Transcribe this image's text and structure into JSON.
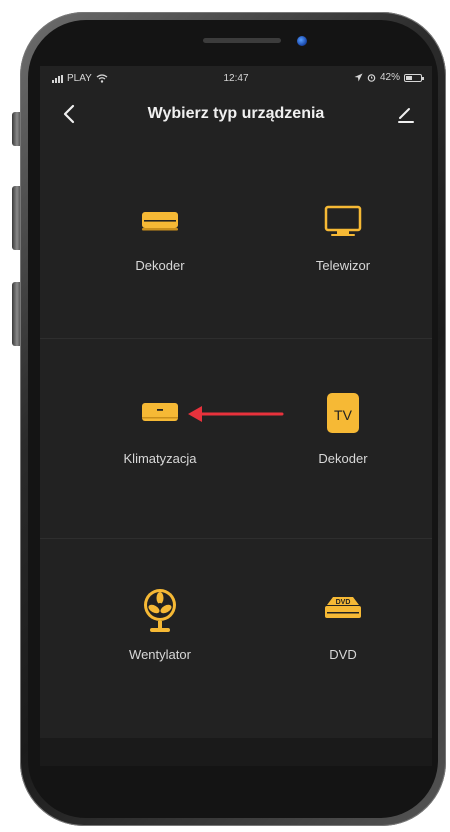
{
  "status": {
    "carrier": "PLAY",
    "time": "12:47",
    "battery": "42%",
    "battery_level": 0.42
  },
  "nav": {
    "title": "Wybierz typ urządzenia",
    "back_icon": "chevron-left-icon",
    "edit_icon": "pencil-icon"
  },
  "devices": [
    {
      "label": "Dekoder",
      "icon": "set-top-box-icon"
    },
    {
      "label": "Telewizor",
      "icon": "tv-icon"
    },
    {
      "label": "Klimatyzacja",
      "icon": "air-conditioner-icon"
    },
    {
      "label": "Dekoder",
      "icon": "tv-badge-icon",
      "badge": "TV"
    },
    {
      "label": "Wentylator",
      "icon": "fan-icon"
    },
    {
      "label": "DVD",
      "icon": "dvd-player-icon",
      "badge": "DVD"
    }
  ],
  "colors": {
    "accent": "#f6b935",
    "background": "#222222",
    "arrow": "#e8323c"
  }
}
